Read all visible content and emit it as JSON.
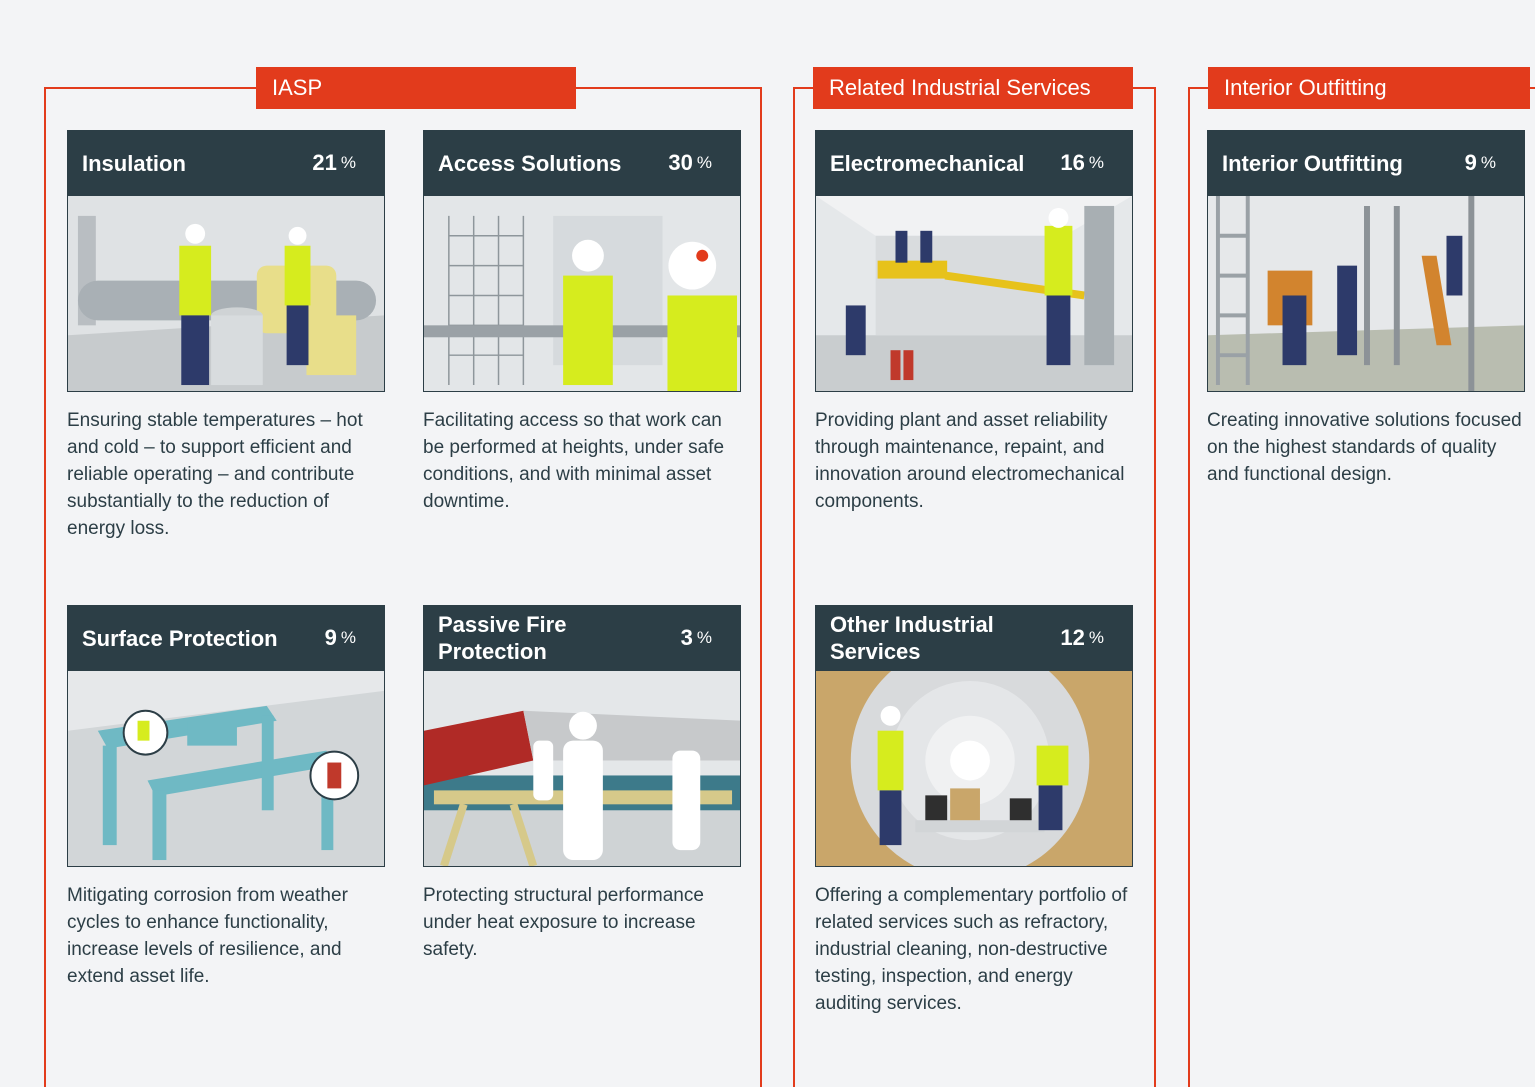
{
  "groups": [
    {
      "label": "IASP"
    },
    {
      "label": "Related Industrial Services"
    },
    {
      "label": "Interior Outfitting"
    }
  ],
  "cards": [
    {
      "title": "Insulation",
      "percent": "21",
      "unit": "%",
      "image_icon": "insulation-illustration",
      "description": "Ensuring stable temperatures – hot and cold – to support efficient and reliable operating – and contribute substantially to the reduction of energy loss."
    },
    {
      "title": "Access Solutions",
      "percent": "30",
      "unit": "%",
      "image_icon": "scaffolding-illustration",
      "description": "Facilitating access so that work can be performed at heights, under safe conditions, and with minimal asset downtime."
    },
    {
      "title": "Surface Protection",
      "percent": "9",
      "unit": "%",
      "image_icon": "gantry-crane-illustration",
      "description": "Mitigating corrosion from weather cycles to enhance functionality, increase levels of resilience, and extend asset life."
    },
    {
      "title": "Passive Fire Protection",
      "percent": "3",
      "unit": "%",
      "image_icon": "fire-protection-illustration",
      "description": "Protecting structural performance under heat exposure to increase safety."
    },
    {
      "title": "Electromechanical",
      "percent": "16",
      "unit": "%",
      "image_icon": "electromechanical-illustration",
      "description": "Providing plant and asset reliability through maintenance, repaint, and innovation around electromechanical components."
    },
    {
      "title": "Other Industrial Services",
      "percent": "12",
      "unit": "%",
      "image_icon": "refractory-illustration",
      "description": "Offering a complementary portfolio of related services such as refractory, industrial cleaning, non-destructive testing, inspection, and energy auditing services."
    },
    {
      "title": "Interior Outfitting",
      "percent": "9",
      "unit": "%",
      "image_icon": "interior-outfitting-illustration",
      "description": "Creating innovative solutions focused on the highest standards of quality and functional design."
    }
  ],
  "colors": {
    "accent": "#e23b1c",
    "header_bg": "#2c3e46",
    "page_bg": "#f3f4f6",
    "hi_vis": "#d6ec1e"
  }
}
